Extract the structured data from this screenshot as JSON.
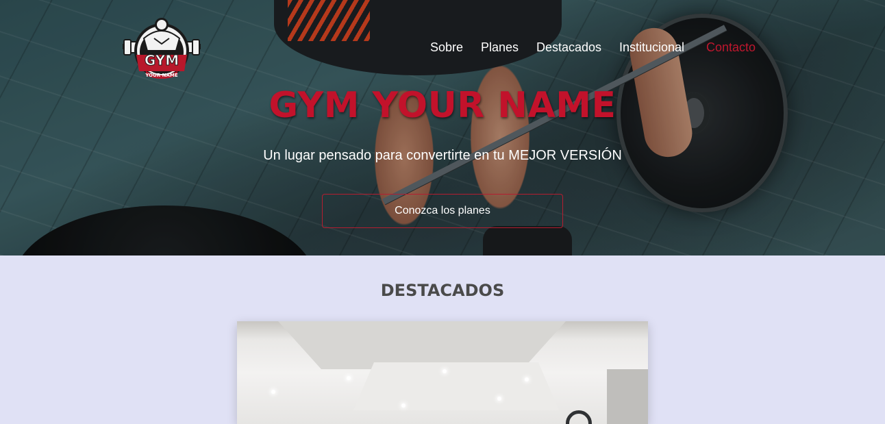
{
  "header": {
    "logo": {
      "main_text": "GYM",
      "sub_text": "YOUR NAME"
    },
    "nav": [
      {
        "label": "Sobre",
        "active": false
      },
      {
        "label": "Planes",
        "active": false
      },
      {
        "label": "Destacados",
        "active": false
      },
      {
        "label": "Institucional",
        "active": false
      },
      {
        "label": "Contacto",
        "active": true
      }
    ]
  },
  "hero": {
    "title": "GYM YOUR NAME",
    "subtitle": "Un lugar pensado para convertirte en tu MEJOR VERSIÓN",
    "cta_label": "Conozca los planes"
  },
  "featured": {
    "title": "DESTACADOS"
  },
  "colors": {
    "accent": "#c2122b",
    "section_bg": "#e0e1f5",
    "heading_text": "#4a4a4a"
  }
}
